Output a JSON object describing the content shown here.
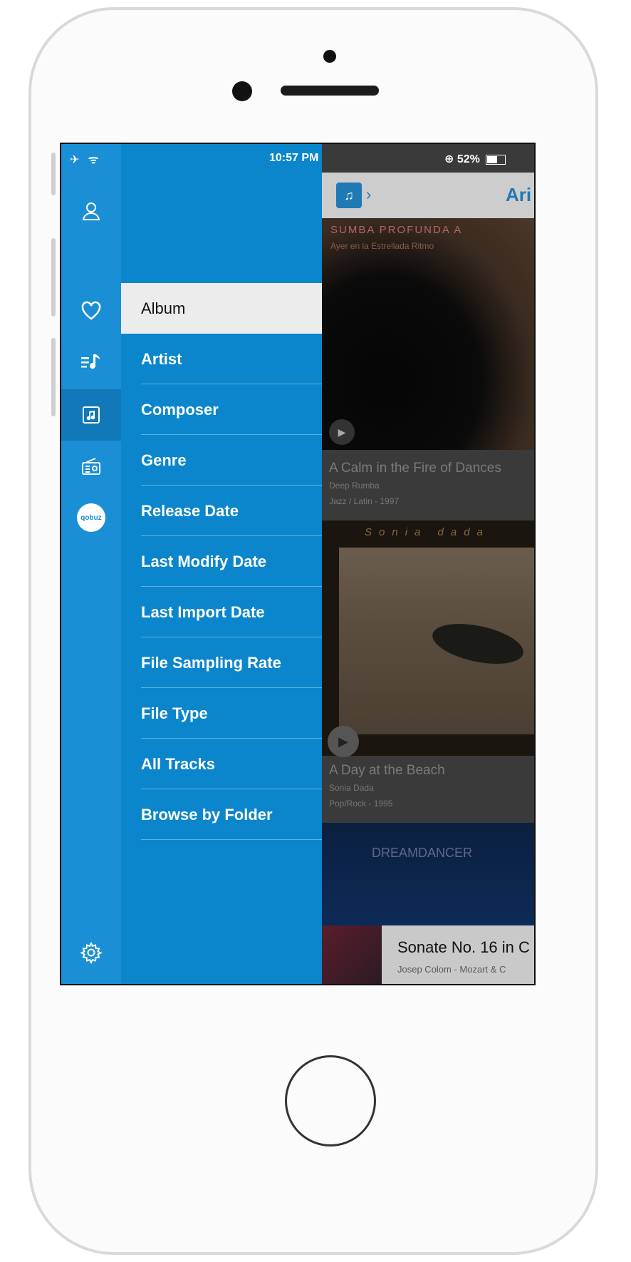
{
  "status_bar": {
    "left_icons": "✈ ᯤ",
    "time": "10:57 PM",
    "battery_text": "⊕ 52%",
    "battery_level": 0.52
  },
  "rail": {
    "items": [
      "profile-icon",
      "heart-icon",
      "playlist-icon",
      "library-icon",
      "radio-icon",
      "qobuz-icon",
      "settings-icon"
    ],
    "qobuz_label": "qobuz",
    "active": "library-icon"
  },
  "menu": {
    "items": [
      {
        "label": "Album",
        "selected": true
      },
      {
        "label": "Artist"
      },
      {
        "label": "Composer"
      },
      {
        "label": "Genre"
      },
      {
        "label": "Release Date"
      },
      {
        "label": "Last Modify Date"
      },
      {
        "label": "Last Import Date"
      },
      {
        "label": "File Sampling Rate"
      },
      {
        "label": "File Type"
      },
      {
        "label": "All Tracks"
      },
      {
        "label": "Browse by Folder"
      }
    ]
  },
  "content": {
    "nav": {
      "icon": "♫",
      "chevron": "›",
      "title": "Ari"
    },
    "albums": [
      {
        "cover_title": "SUMBA PROFUNDA A",
        "cover_subtitle": "Ayer en la Estrellada Ritmo",
        "title": "A Calm in the Fire of Dances",
        "artist": "Deep Rumba",
        "meta": "Jazz / Latin - 1997"
      },
      {
        "cover_title": "Sonia dada",
        "title": "A Day at the Beach",
        "artist": "Sonia Dada",
        "meta": "Pop/Rock - 1995"
      },
      {
        "cover_title": "DREAMDANCER"
      }
    ],
    "now_playing": {
      "title": "Sonate No. 16 in C",
      "subtitle": "Josep Colom - Mozart & C"
    }
  },
  "colors": {
    "rail": "#1a8fd6",
    "menu": "#0b86cc",
    "selected_bg": "#ececec",
    "accent": "#1f79b5"
  }
}
